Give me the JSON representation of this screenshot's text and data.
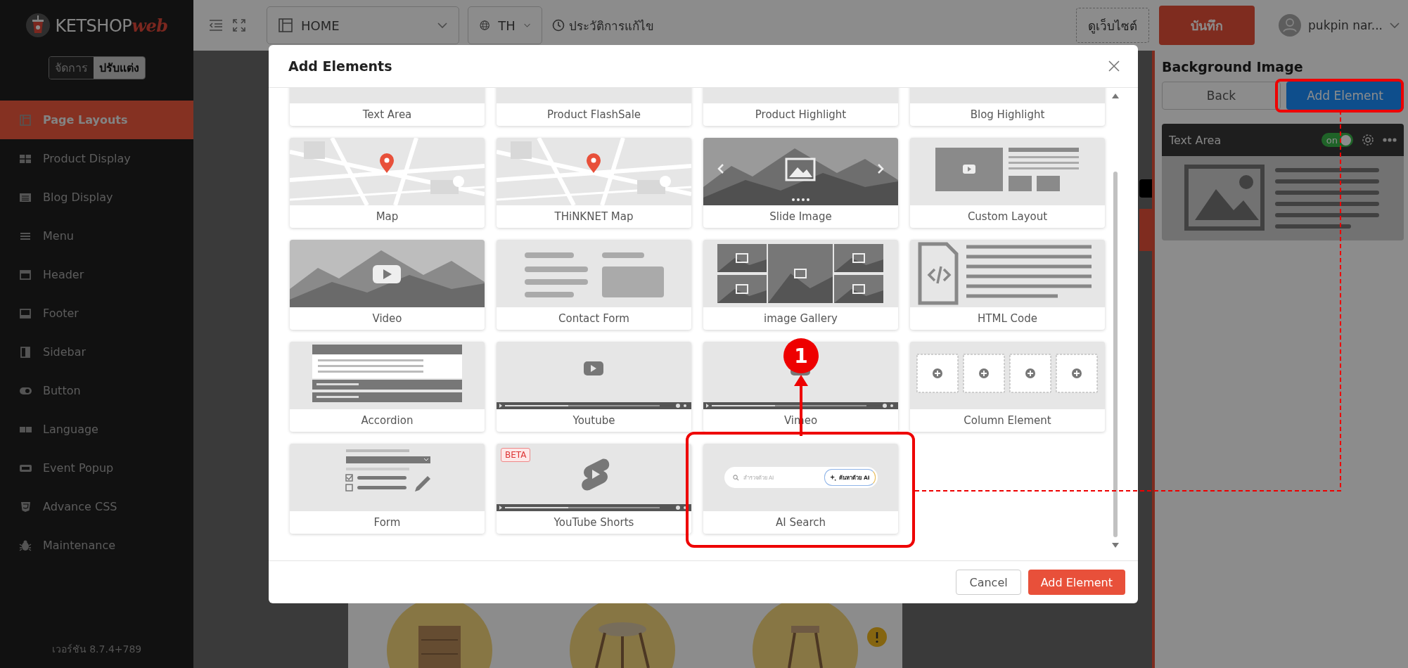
{
  "sidebar": {
    "logo": {
      "text": "KETSHOP",
      "accent": "web"
    },
    "mode_toggle": [
      {
        "label": "จัดการ",
        "selected": false
      },
      {
        "label": "ปรับแต่ง",
        "selected": true
      }
    ],
    "items": [
      {
        "label": "Page Layouts",
        "selected": true
      },
      {
        "label": "Product Display",
        "selected": false
      },
      {
        "label": "Blog Display",
        "selected": false
      },
      {
        "label": "Menu",
        "selected": false
      },
      {
        "label": "Header",
        "selected": false
      },
      {
        "label": "Footer",
        "selected": false
      },
      {
        "label": "Sidebar",
        "selected": false
      },
      {
        "label": "Button",
        "selected": false
      },
      {
        "label": "Language",
        "selected": false
      },
      {
        "label": "Event Popup",
        "selected": false
      },
      {
        "label": "Advance CSS",
        "selected": false
      },
      {
        "label": "Maintenance",
        "selected": false
      }
    ],
    "version": "เวอร์ชัน 8.7.4+789"
  },
  "topbar": {
    "page_select": "HOME",
    "language_select": "TH",
    "history_link": "ประวัติการแก้ไข",
    "view_site_button": "ดูเว็บไซต์",
    "save_button": "บันทึก",
    "user_name": "pukpin nar..."
  },
  "modal": {
    "title": "Add Elements",
    "elements": [
      {
        "label": "Text Area"
      },
      {
        "label": "Product FlashSale"
      },
      {
        "label": "Product Highlight"
      },
      {
        "label": "Blog Highlight"
      },
      {
        "label": "Map",
        "kind": "map"
      },
      {
        "label": "THiNKNET Map",
        "kind": "map"
      },
      {
        "label": "Slide Image",
        "kind": "slider"
      },
      {
        "label": "Custom Layout",
        "kind": "custom_layout"
      },
      {
        "label": "Video",
        "kind": "video"
      },
      {
        "label": "Contact Form",
        "kind": "contact_form"
      },
      {
        "label": "image Gallery",
        "kind": "gallery"
      },
      {
        "label": "HTML Code",
        "kind": "html"
      },
      {
        "label": "Accordion",
        "kind": "accordion"
      },
      {
        "label": "Youtube",
        "kind": "player"
      },
      {
        "label": "Vimeo",
        "kind": "player"
      },
      {
        "label": "Column Element",
        "kind": "columns"
      },
      {
        "label": "Form",
        "kind": "form"
      },
      {
        "label": "YouTube Shorts",
        "kind": "shorts",
        "badge": "BETA"
      },
      {
        "label": "AI Search",
        "kind": "ai_search",
        "search_placeholder": "สำรวจด้วย AI",
        "search_button": "ค้นหาด้วย AI"
      }
    ],
    "buttons": [
      {
        "label": "Cancel",
        "kind": "secondary"
      },
      {
        "label": "Add Element",
        "kind": "primary"
      }
    ]
  },
  "right_panel": {
    "title": "Background Image",
    "buttons": [
      {
        "label": "Back",
        "kind": "secondary"
      },
      {
        "label": "Add Element",
        "kind": "primary"
      }
    ],
    "elements": [
      {
        "name": "Text Area",
        "on": true,
        "toggle_label": "on"
      }
    ]
  },
  "annotations": {
    "step": "1"
  }
}
